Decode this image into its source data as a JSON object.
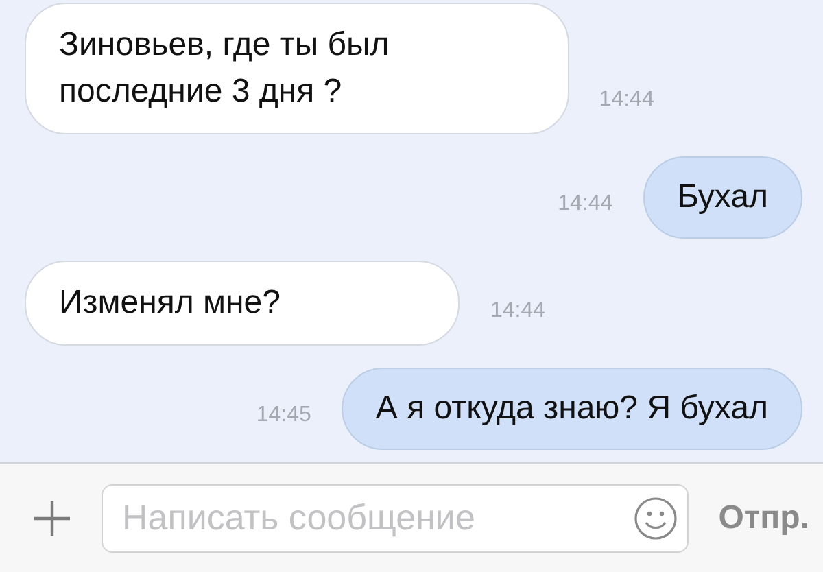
{
  "messages": [
    {
      "kind": "incoming",
      "text": "Зиновьев, где ты был\nпоследние 3 дня ?",
      "time": "14:44"
    },
    {
      "kind": "outgoing",
      "text": "Бухал",
      "time": "14:44"
    },
    {
      "kind": "incoming",
      "text": "Изменял мне?",
      "time": "14:44"
    },
    {
      "kind": "outgoing",
      "text": "А я откуда знаю? Я бухал",
      "time": "14:45"
    }
  ],
  "composer": {
    "placeholder": "Написать сообщение",
    "send_label": "Отпр."
  }
}
